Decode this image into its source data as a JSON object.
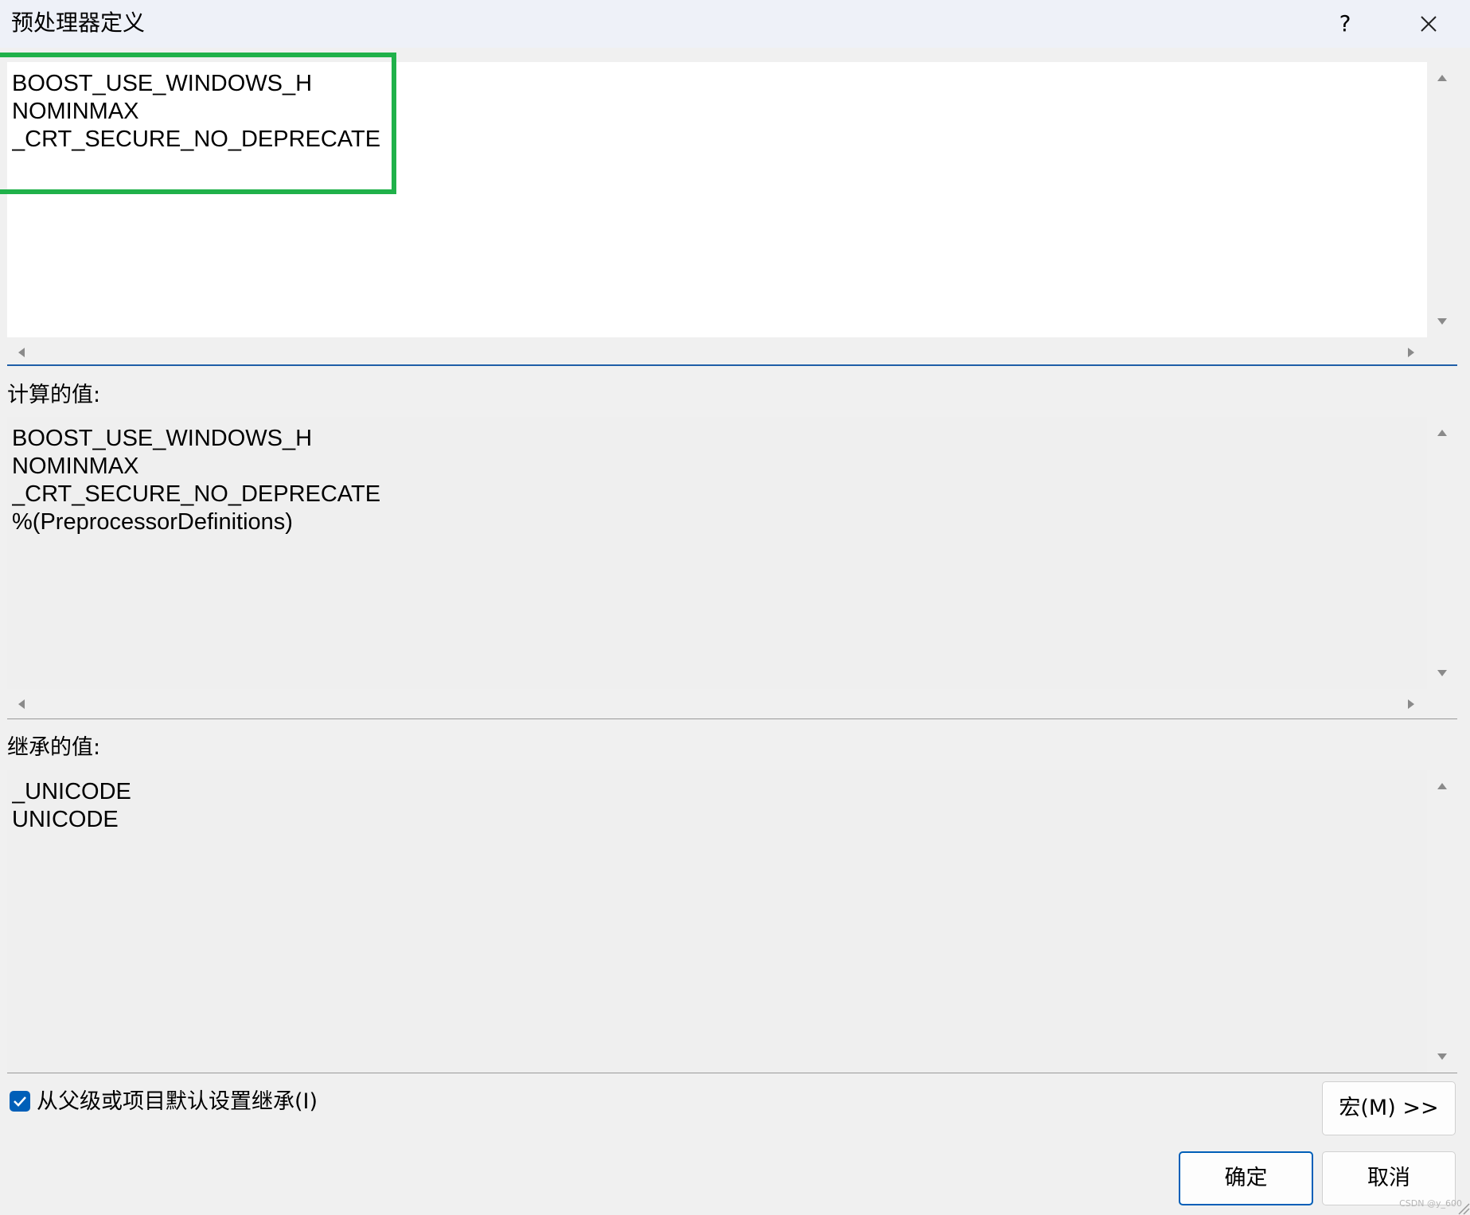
{
  "window": {
    "title": "预处理器定义",
    "help_label": "?",
    "close_icon": "close-icon"
  },
  "editor": {
    "text": "BOOST_USE_WINDOWS_H\nNOMINMAX\n_CRT_SECURE_NO_DEPRECATE"
  },
  "evaluated": {
    "label": "计算的值:",
    "text": "BOOST_USE_WINDOWS_H\nNOMINMAX\n_CRT_SECURE_NO_DEPRECATE\n%(PreprocessorDefinitions)"
  },
  "inherited": {
    "label": "继承的值:",
    "text": "_UNICODE\nUNICODE"
  },
  "inherit_checkbox": {
    "label": "从父级或项目默认设置继承(I)",
    "checked": true
  },
  "buttons": {
    "macros": "宏(M) >>",
    "ok": "确定",
    "cancel": "取消"
  },
  "watermark": "CSDN @y_600",
  "colors": {
    "highlight": "#20b14a",
    "accent": "#005fb8",
    "edit_background": "#ffffff",
    "readonly_background": "#efefef"
  }
}
